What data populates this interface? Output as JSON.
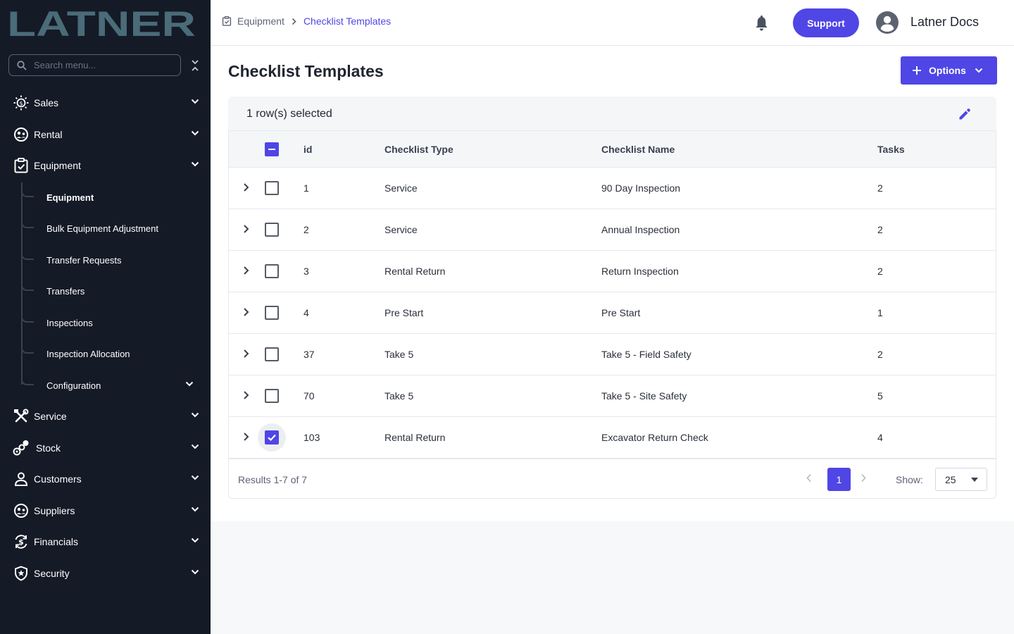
{
  "app": {
    "logo_text": "LATNER"
  },
  "sidebar": {
    "search_placeholder": "Search menu...",
    "items": [
      {
        "label": "Sales",
        "icon": "sales-icon"
      },
      {
        "label": "Rental",
        "icon": "rental-icon"
      },
      {
        "label": "Equipment",
        "icon": "equipment-icon"
      },
      {
        "label": "Service",
        "icon": "service-icon"
      },
      {
        "label": "Stock",
        "icon": "stock-icon"
      },
      {
        "label": "Customers",
        "icon": "customers-icon"
      },
      {
        "label": "Suppliers",
        "icon": "suppliers-icon"
      },
      {
        "label": "Financials",
        "icon": "financials-icon"
      },
      {
        "label": "Security",
        "icon": "security-icon"
      }
    ],
    "equipment_sub": [
      {
        "label": "Equipment",
        "active": true
      },
      {
        "label": "Bulk Equipment Adjustment"
      },
      {
        "label": "Transfer Requests"
      },
      {
        "label": "Transfers"
      },
      {
        "label": "Inspections"
      },
      {
        "label": "Inspection Allocation"
      },
      {
        "label": "Configuration"
      }
    ]
  },
  "header": {
    "breadcrumb": {
      "parent": "Equipment",
      "current": "Checklist Templates"
    },
    "support_label": "Support",
    "user_name": "Latner Docs"
  },
  "main": {
    "title": "Checklist Templates",
    "options_label": "Options",
    "selection_text": "1 row(s) selected",
    "table": {
      "columns": [
        "id",
        "Checklist Type",
        "Checklist Name",
        "Tasks"
      ],
      "rows": [
        {
          "id": "1",
          "type": "Service",
          "name": "90 Day Inspection",
          "tasks": "2",
          "checked": false
        },
        {
          "id": "2",
          "type": "Service",
          "name": "Annual Inspection",
          "tasks": "2",
          "checked": false
        },
        {
          "id": "3",
          "type": "Rental Return",
          "name": "Return Inspection",
          "tasks": "2",
          "checked": false
        },
        {
          "id": "4",
          "type": "Pre Start",
          "name": "Pre Start",
          "tasks": "1",
          "checked": false
        },
        {
          "id": "37",
          "type": "Take 5",
          "name": "Take 5 - Field Safety",
          "tasks": "2",
          "checked": false
        },
        {
          "id": "70",
          "type": "Take 5",
          "name": "Take 5 - Site Safety",
          "tasks": "5",
          "checked": false
        },
        {
          "id": "103",
          "type": "Rental Return",
          "name": "Excavator Return Check",
          "tasks": "4",
          "checked": true
        }
      ]
    },
    "footer": {
      "results": "Results 1-7 of 7",
      "page": "1",
      "show_label": "Show:",
      "page_size": "25"
    }
  },
  "colors": {
    "accent": "#4f46e5",
    "sidebar_bg": "#141a26",
    "logo": "#4a6b78"
  }
}
